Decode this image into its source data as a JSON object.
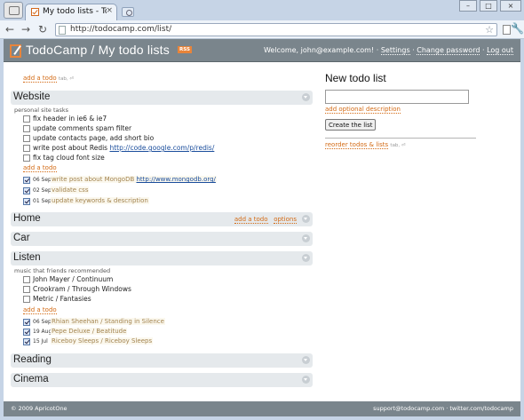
{
  "browser": {
    "tab_title": "My todo lists - TodoCa",
    "tab_close": "×",
    "url": "http://todocamp.com/list/",
    "back": "←",
    "forward": "→",
    "reload": "↻",
    "star": "☆",
    "wrench": "🔧",
    "win_min": "–",
    "win_max": "□",
    "win_close": "×"
  },
  "header": {
    "title": "TodoCamp / My todo lists",
    "rss": "RSS",
    "welcome": "Welcome, john@example.com!",
    "sep": " · ",
    "settings": "Settings",
    "change_password": "Change password",
    "logout": "Log out"
  },
  "main": {
    "add_todo": "add a todo",
    "add_todo_hint": "tab, ⏎",
    "lists": [
      {
        "title": "Website",
        "description": "personal site tasks",
        "todos": [
          {
            "text": "fix header in ie6 & ie7"
          },
          {
            "text": "update comments spam filter"
          },
          {
            "text": "update contacts page, add short bio"
          },
          {
            "text": "write post about Redis ",
            "link": "http://code.google.com/p/redis/"
          },
          {
            "text": "fix tag cloud font size"
          }
        ],
        "add_link": "add a todo",
        "done": [
          {
            "date": "06 Sep",
            "text": "write post about MongoDB ",
            "link": "http://www.mongodb.org/"
          },
          {
            "date": "02 Sep",
            "text": "validate css"
          },
          {
            "date": "01 Sep",
            "text": "update keywords & description"
          }
        ]
      },
      {
        "title": "Home",
        "add_link": "add a todo",
        "options": "options"
      },
      {
        "title": "Car"
      },
      {
        "title": "Listen",
        "description": "music that friends recommended",
        "todos": [
          {
            "text": "John Mayer / Continuum"
          },
          {
            "text": "Crookram / Through Windows"
          },
          {
            "text": "Metric / Fantasies"
          }
        ],
        "add_link": "add a todo",
        "done": [
          {
            "date": "06 Sep",
            "text": "Rhian Sheehan / Standing in Silence"
          },
          {
            "date": "19 Aug",
            "text": "Pepe Deluxe / Beatitude"
          },
          {
            "date": "15 Jul",
            "text": "Riceboy Sleeps / Riceboy Sleeps"
          }
        ]
      },
      {
        "title": "Reading"
      },
      {
        "title": "Cinema"
      }
    ]
  },
  "sidebar": {
    "title": "New todo list",
    "input_value": "",
    "add_description": "add optional description",
    "create_button": "Create the list",
    "reorder": "reorder todos & lists",
    "reorder_hint": "tab, ⏎"
  },
  "footer": {
    "copyright": "© 2009 ApricotOne",
    "support": "support@todocamp.com",
    "sep": " · ",
    "twitter": "twitter.com/todocamp"
  },
  "colors": {
    "accent": "#d36a14",
    "header_bg": "#7a858c",
    "list_header_bg": "#e5e9ec",
    "link": "#1a4d9c"
  }
}
